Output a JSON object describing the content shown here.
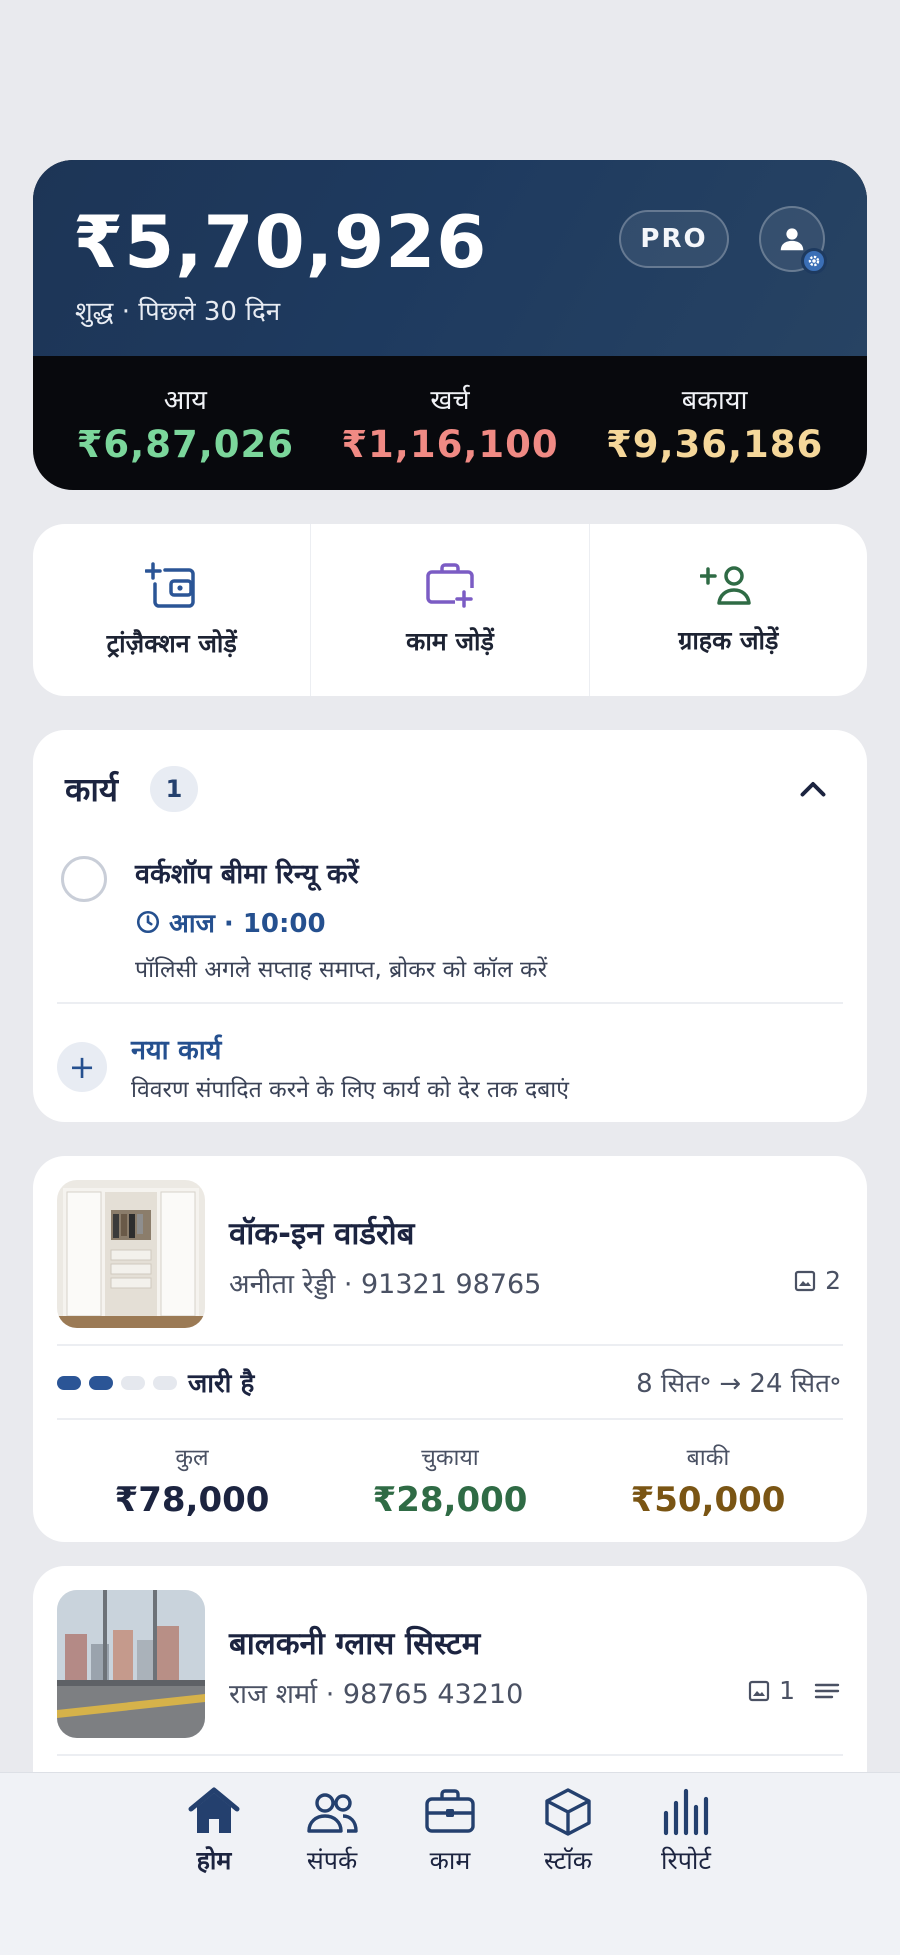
{
  "summary": {
    "net_amount": "₹5,70,926",
    "subtitle": "शुद्ध · पिछले 30 दिन",
    "pro_label": "PRO",
    "income_label": "आय",
    "income_value": "₹6,87,026",
    "expense_label": "खर्च",
    "expense_value": "₹1,16,100",
    "due_label": "बकाया",
    "due_value": "₹9,36,186",
    "colors": {
      "income": "#7bd69b",
      "expense": "#f08a84",
      "due": "#f5d79a"
    }
  },
  "quick_actions": [
    {
      "label": "ट्रांज़ैक्शन जोड़ें",
      "icon": "wallet-add-icon",
      "color": "#2b5596"
    },
    {
      "label": "काम जोड़ें",
      "icon": "briefcase-add-icon",
      "color": "#7b5cc4"
    },
    {
      "label": "ग्राहक जोड़ें",
      "icon": "user-add-icon",
      "color": "#2f6b45"
    }
  ],
  "tasks": {
    "title": "कार्य",
    "count": "1",
    "item": {
      "title": "वर्कशॉप बीमा रिन्यू करें",
      "time": "आज · 10:00",
      "description": "पॉलिसी अगले सप्ताह समाप्त, ब्रोकर को कॉल करें"
    },
    "new_task_title": "नया कार्य",
    "new_task_hint": "विवरण संपादित करने के लिए कार्य को देर तक दबाएं"
  },
  "jobs": [
    {
      "title": "वॉक-इन वार्डरोब",
      "client": "अनीता रेड्डी · 91321 98765",
      "photo_count": "2",
      "status": "जारी है",
      "progress": 0.5,
      "dates": "8 सित॰ → 24 सित॰",
      "total_label": "कुल",
      "total": "₹78,000",
      "paid_label": "चुकाया",
      "paid": "₹28,000",
      "balance_label": "बाकी",
      "balance": "₹50,000"
    },
    {
      "title": "बालकनी ग्लास सिस्टम",
      "client": "राज शर्मा · 98765 43210",
      "photo_count": "1"
    }
  ],
  "nav": [
    {
      "label": "होम",
      "icon": "home-icon",
      "active": true
    },
    {
      "label": "संपर्क",
      "icon": "contacts-icon"
    },
    {
      "label": "काम",
      "icon": "briefcase-icon"
    },
    {
      "label": "स्टॉक",
      "icon": "box-icon"
    },
    {
      "label": "रिपोर्ट",
      "icon": "bar-chart-icon"
    }
  ]
}
